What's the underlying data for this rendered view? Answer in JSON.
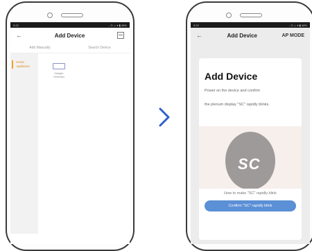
{
  "colors": {
    "accent_blue": "#2f5fd0",
    "button_blue": "#5b8fd6",
    "category_orange": "#e08a1e",
    "sc_circle_gray": "#9e9a99",
    "illustration_bg": "#f6efec"
  },
  "left_phone": {
    "status_time": "9:22",
    "status_icons": "...⊙ ☼ ▾ ▮ 48%",
    "nav": {
      "back_icon": "←",
      "title": "Add Device",
      "scan_icon": "scan-icon"
    },
    "tabs": [
      "Add Manually",
      "Search Device"
    ],
    "categories": [
      "Home Appliance"
    ],
    "device": {
      "label": "Halogen Generator"
    }
  },
  "arrow_icon": "chevron-right-icon",
  "right_phone": {
    "status_time": "9:22",
    "status_icons": "...⊙ ☼ ▾ ▮ 48%",
    "nav": {
      "back_icon": "←",
      "title": "Add Device",
      "right_action": "AP MODE"
    },
    "card": {
      "title": "Add Device",
      "line1": "Power on the device and confirm",
      "line2": "the plenum display \"SC\" rapidly blinks.",
      "sc_display": "SC",
      "how_link": "How to make \"SC\" rapidly blink",
      "confirm_button": "Confirm \"SC\" rapidly blink"
    }
  }
}
